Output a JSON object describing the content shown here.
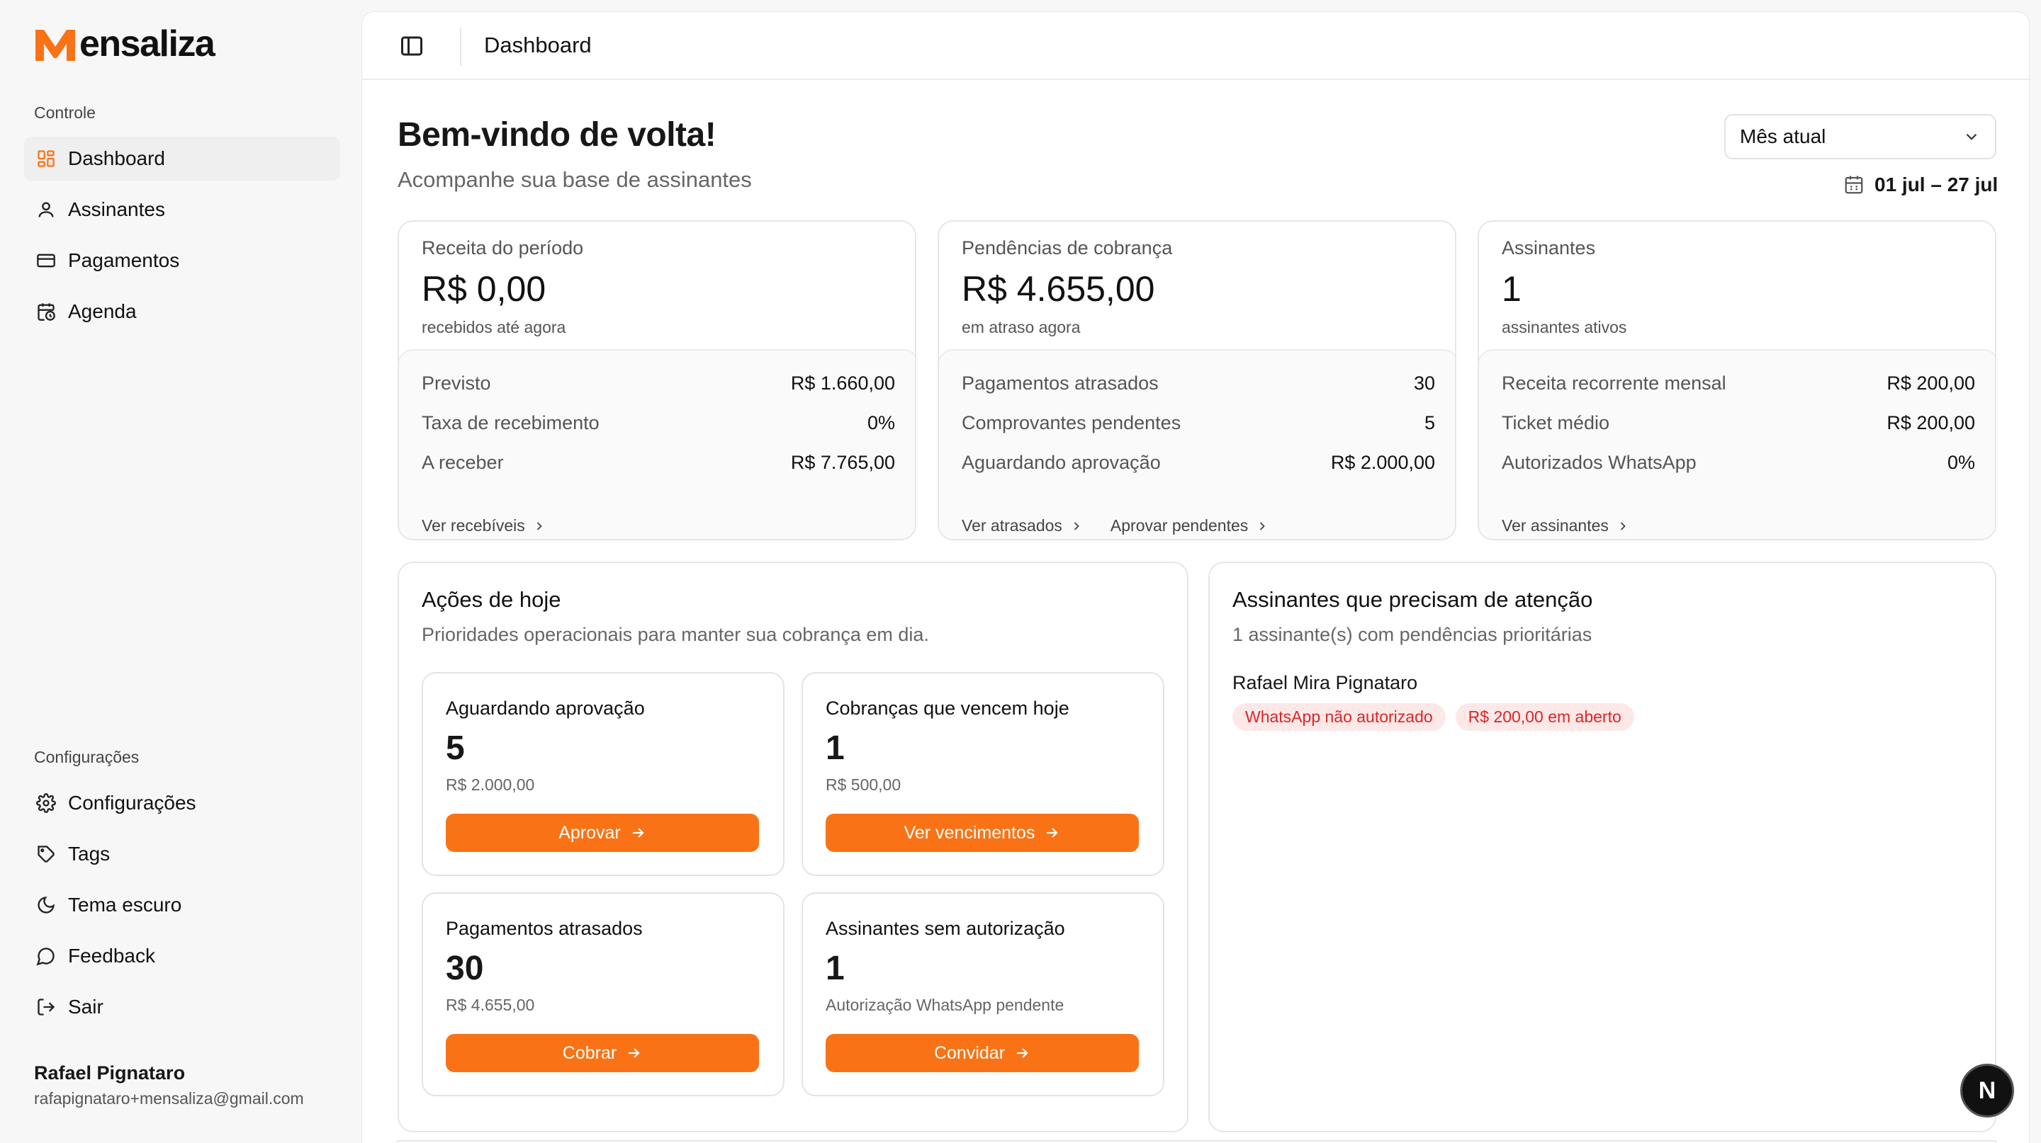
{
  "brand": {
    "name": "ensaliza",
    "accent": "#f97316"
  },
  "sidebar": {
    "section_control": "Controle",
    "nav": [
      {
        "label": "Dashboard",
        "icon": "grid-icon"
      },
      {
        "label": "Assinantes",
        "icon": "user-icon"
      },
      {
        "label": "Pagamentos",
        "icon": "credit-card-icon"
      },
      {
        "label": "Agenda",
        "icon": "calendar-clock-icon"
      }
    ],
    "section_settings": "Configurações",
    "settings": [
      {
        "label": "Configurações",
        "icon": "gear-icon"
      },
      {
        "label": "Tags",
        "icon": "tag-icon"
      },
      {
        "label": "Tema escuro",
        "icon": "moon-icon"
      },
      {
        "label": "Feedback",
        "icon": "chat-bubble-icon"
      },
      {
        "label": "Sair",
        "icon": "logout-icon"
      }
    ],
    "user": {
      "name": "Rafael Pignataro",
      "email": "rafapignataro+mensaliza@gmail.com"
    }
  },
  "topbar": {
    "title": "Dashboard"
  },
  "header": {
    "title": "Bem-vindo de volta!",
    "subtitle": "Acompanhe sua base de assinantes",
    "period_select": "Mês atual",
    "date_range": "01 jul – 27 jul"
  },
  "kpis": [
    {
      "label": "Receita do período",
      "value": "R$ 0,00",
      "sub": "recebidos até agora",
      "rows": [
        {
          "label": "Previsto",
          "value": "R$ 1.660,00"
        },
        {
          "label": "Taxa de recebimento",
          "value": "0%"
        },
        {
          "label": "A receber",
          "value": "R$ 7.765,00"
        }
      ],
      "links": [
        "Ver recebíveis"
      ]
    },
    {
      "label": "Pendências de cobrança",
      "value": "R$ 4.655,00",
      "sub": "em atraso agora",
      "rows": [
        {
          "label": "Pagamentos atrasados",
          "value": "30"
        },
        {
          "label": "Comprovantes pendentes",
          "value": "5"
        },
        {
          "label": "Aguardando aprovação",
          "value": "R$ 2.000,00"
        }
      ],
      "links": [
        "Ver atrasados",
        "Aprovar pendentes"
      ]
    },
    {
      "label": "Assinantes",
      "value": "1",
      "sub": "assinantes ativos",
      "rows": [
        {
          "label": "Receita recorrente mensal",
          "value": "R$ 200,00"
        },
        {
          "label": "Ticket médio",
          "value": "R$ 200,00"
        },
        {
          "label": "Autorizados WhatsApp",
          "value": "0%"
        }
      ],
      "links": [
        "Ver assinantes"
      ]
    }
  ],
  "actions": {
    "title": "Ações de hoje",
    "subtitle": "Prioridades operacionais para manter sua cobrança em dia.",
    "cards": [
      {
        "title": "Aguardando aprovação",
        "value": "5",
        "sub": "R$ 2.000,00",
        "button": "Aprovar"
      },
      {
        "title": "Cobranças que vencem hoje",
        "value": "1",
        "sub": "R$ 500,00",
        "button": "Ver vencimentos"
      },
      {
        "title": "Pagamentos atrasados",
        "value": "30",
        "sub": "R$ 4.655,00",
        "button": "Cobrar"
      },
      {
        "title": "Assinantes sem autorização",
        "value": "1",
        "sub": "Autorização WhatsApp pendente",
        "button": "Convidar"
      }
    ]
  },
  "attention": {
    "title": "Assinantes que precisam de atenção",
    "subtitle": "1 assinante(s) com pendências prioritárias",
    "items": [
      {
        "name": "Rafael Mira Pignataro",
        "badges": [
          "WhatsApp não autorizado",
          "R$ 200,00 em aberto"
        ]
      }
    ]
  },
  "fab": {
    "letter": "N"
  }
}
